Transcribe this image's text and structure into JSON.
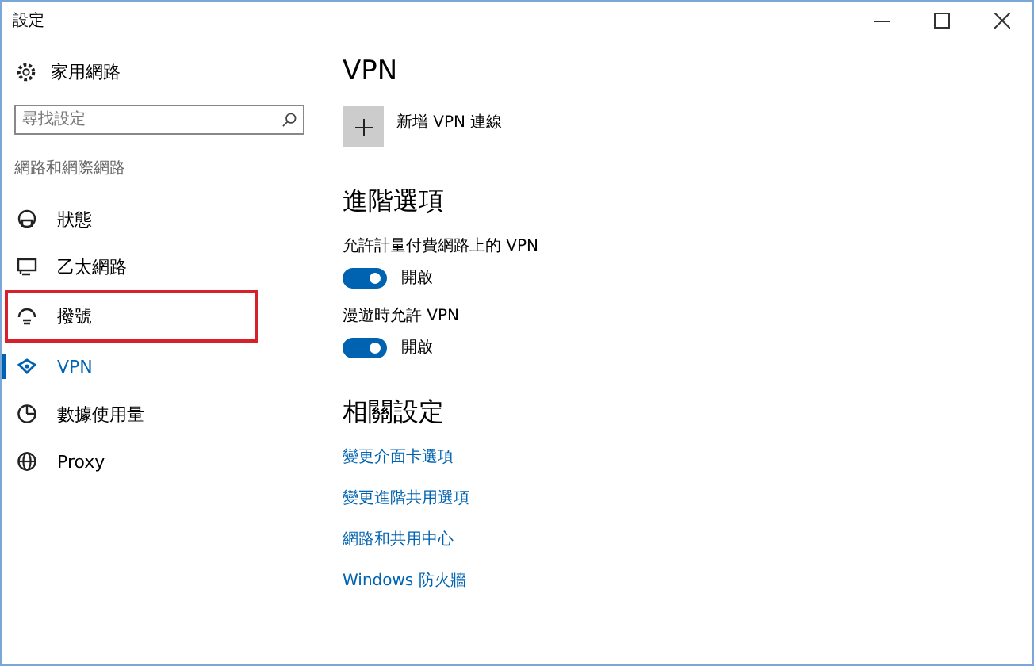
{
  "window": {
    "title": "設定"
  },
  "sidebar": {
    "home": "家用網路",
    "search": {
      "placeholder": "尋找設定"
    },
    "section": "網路和網際網路",
    "items": [
      {
        "label": "狀態",
        "selected": false,
        "highlighted": false
      },
      {
        "label": "乙太網路",
        "selected": false,
        "highlighted": false
      },
      {
        "label": "撥號",
        "selected": false,
        "highlighted": true
      },
      {
        "label": "VPN",
        "selected": true,
        "highlighted": false
      },
      {
        "label": "數據使用量",
        "selected": false,
        "highlighted": false
      },
      {
        "label": "Proxy",
        "selected": false,
        "highlighted": false
      }
    ]
  },
  "content": {
    "title": "VPN",
    "add_label": "新增 VPN 連線",
    "advanced_title": "進階選項",
    "toggles": [
      {
        "label": "允許計量付費網路上的 VPN",
        "on": true,
        "state": "開啟"
      },
      {
        "label": "漫遊時允許 VPN",
        "on": true,
        "state": "開啟"
      }
    ],
    "related_title": "相關設定",
    "links": [
      "變更介面卡選項",
      "變更進階共用選項",
      "網路和共用中心",
      "Windows 防火牆"
    ]
  }
}
